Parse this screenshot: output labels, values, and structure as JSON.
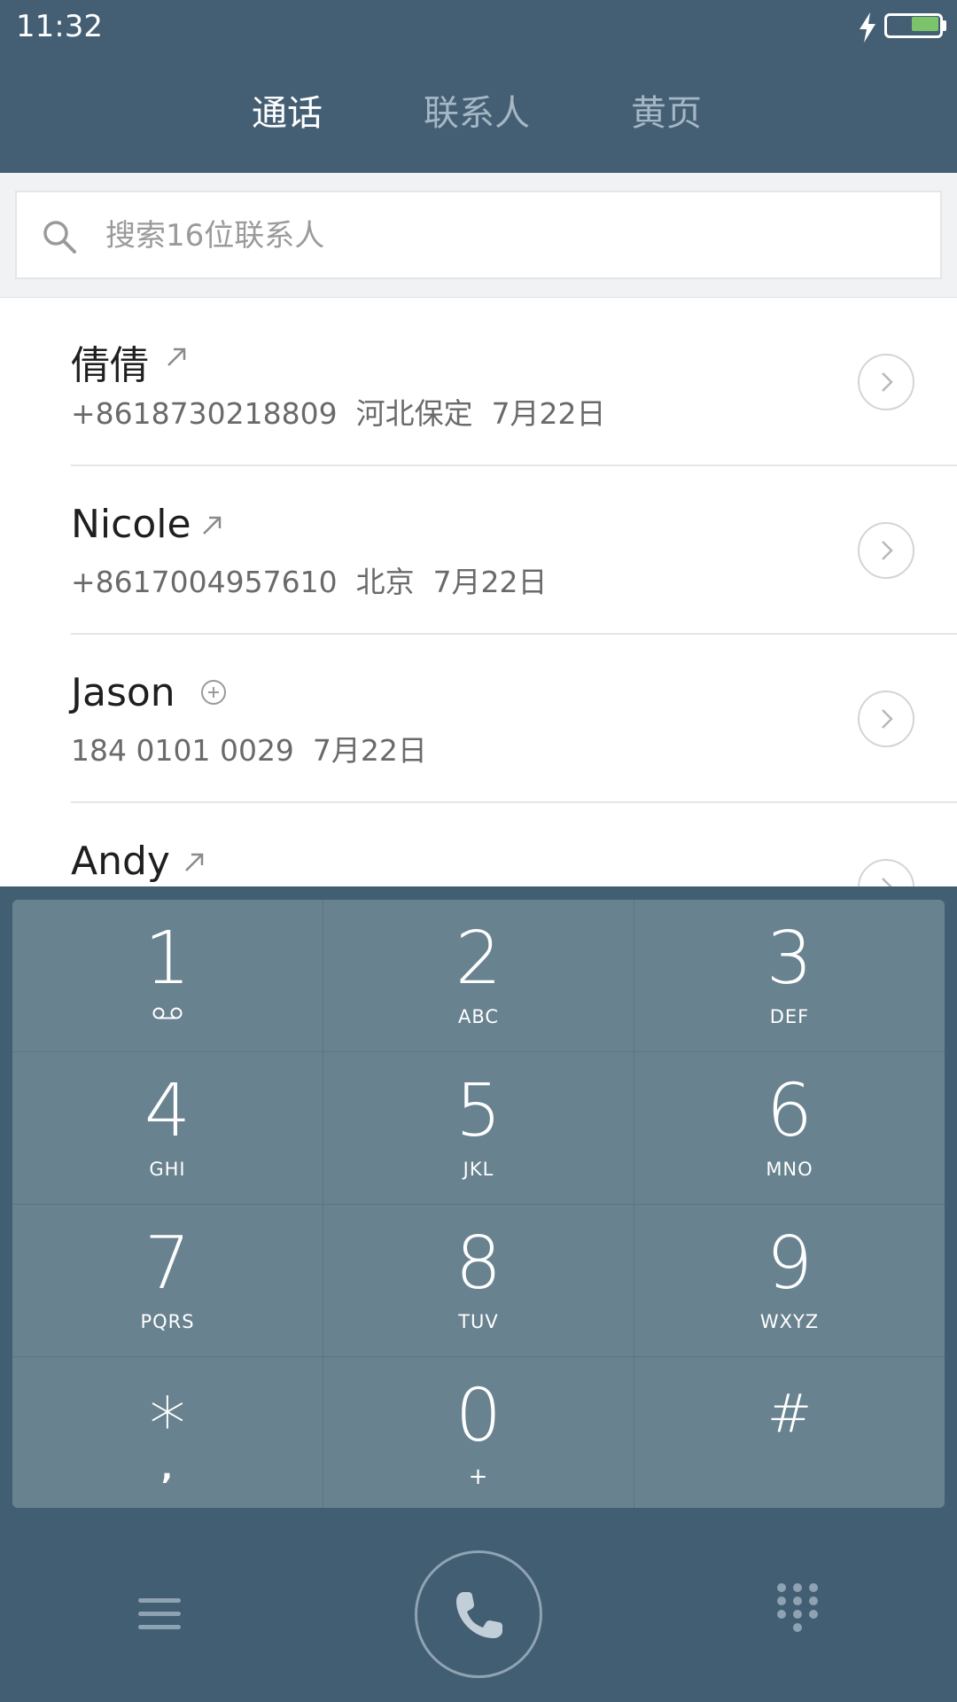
{
  "status_bar": {
    "time": "11:32",
    "battery_color": "#7cc46c"
  },
  "tabs": [
    {
      "label": "通话",
      "active": true
    },
    {
      "label": "联系人",
      "active": false
    },
    {
      "label": "黄页",
      "active": false
    }
  ],
  "search": {
    "placeholder": "搜索16位联系人",
    "value": ""
  },
  "calls": [
    {
      "name": "倩倩",
      "type_icon": "outgoing-arrow-icon",
      "number": "+8618730218809",
      "location": "河北保定",
      "date": "7月22日"
    },
    {
      "name": "Nicole",
      "type_icon": "outgoing-arrow-icon",
      "number": "+8617004957610",
      "location": "北京",
      "date": "7月22日"
    },
    {
      "name": "Jason",
      "type_icon": "add-contact-icon",
      "number": "184 0101 0029",
      "location": "",
      "date": "7月22日"
    },
    {
      "name": "Andy",
      "type_icon": "outgoing-arrow-icon",
      "number": "",
      "location": "",
      "date": ""
    }
  ],
  "keypad": [
    {
      "digit": "1",
      "letters": "",
      "icon": "voicemail-icon"
    },
    {
      "digit": "2",
      "letters": "ABC"
    },
    {
      "digit": "3",
      "letters": "DEF"
    },
    {
      "digit": "4",
      "letters": "GHI"
    },
    {
      "digit": "5",
      "letters": "JKL"
    },
    {
      "digit": "6",
      "letters": "MNO"
    },
    {
      "digit": "7",
      "letters": "PQRS"
    },
    {
      "digit": "8",
      "letters": "TUV"
    },
    {
      "digit": "9",
      "letters": "WXYZ"
    },
    {
      "digit": "*",
      "letters": ","
    },
    {
      "digit": "0",
      "letters": "+"
    },
    {
      "digit": "#",
      "letters": ""
    }
  ],
  "bottom_bar": {
    "menu_icon": "menu-icon",
    "call_icon": "phone-icon",
    "dialpad_icon": "dialpad-icon"
  },
  "colors": {
    "header": "#445f74",
    "dialer_bg": "#425e73",
    "keypad_bg": "#68828f"
  }
}
